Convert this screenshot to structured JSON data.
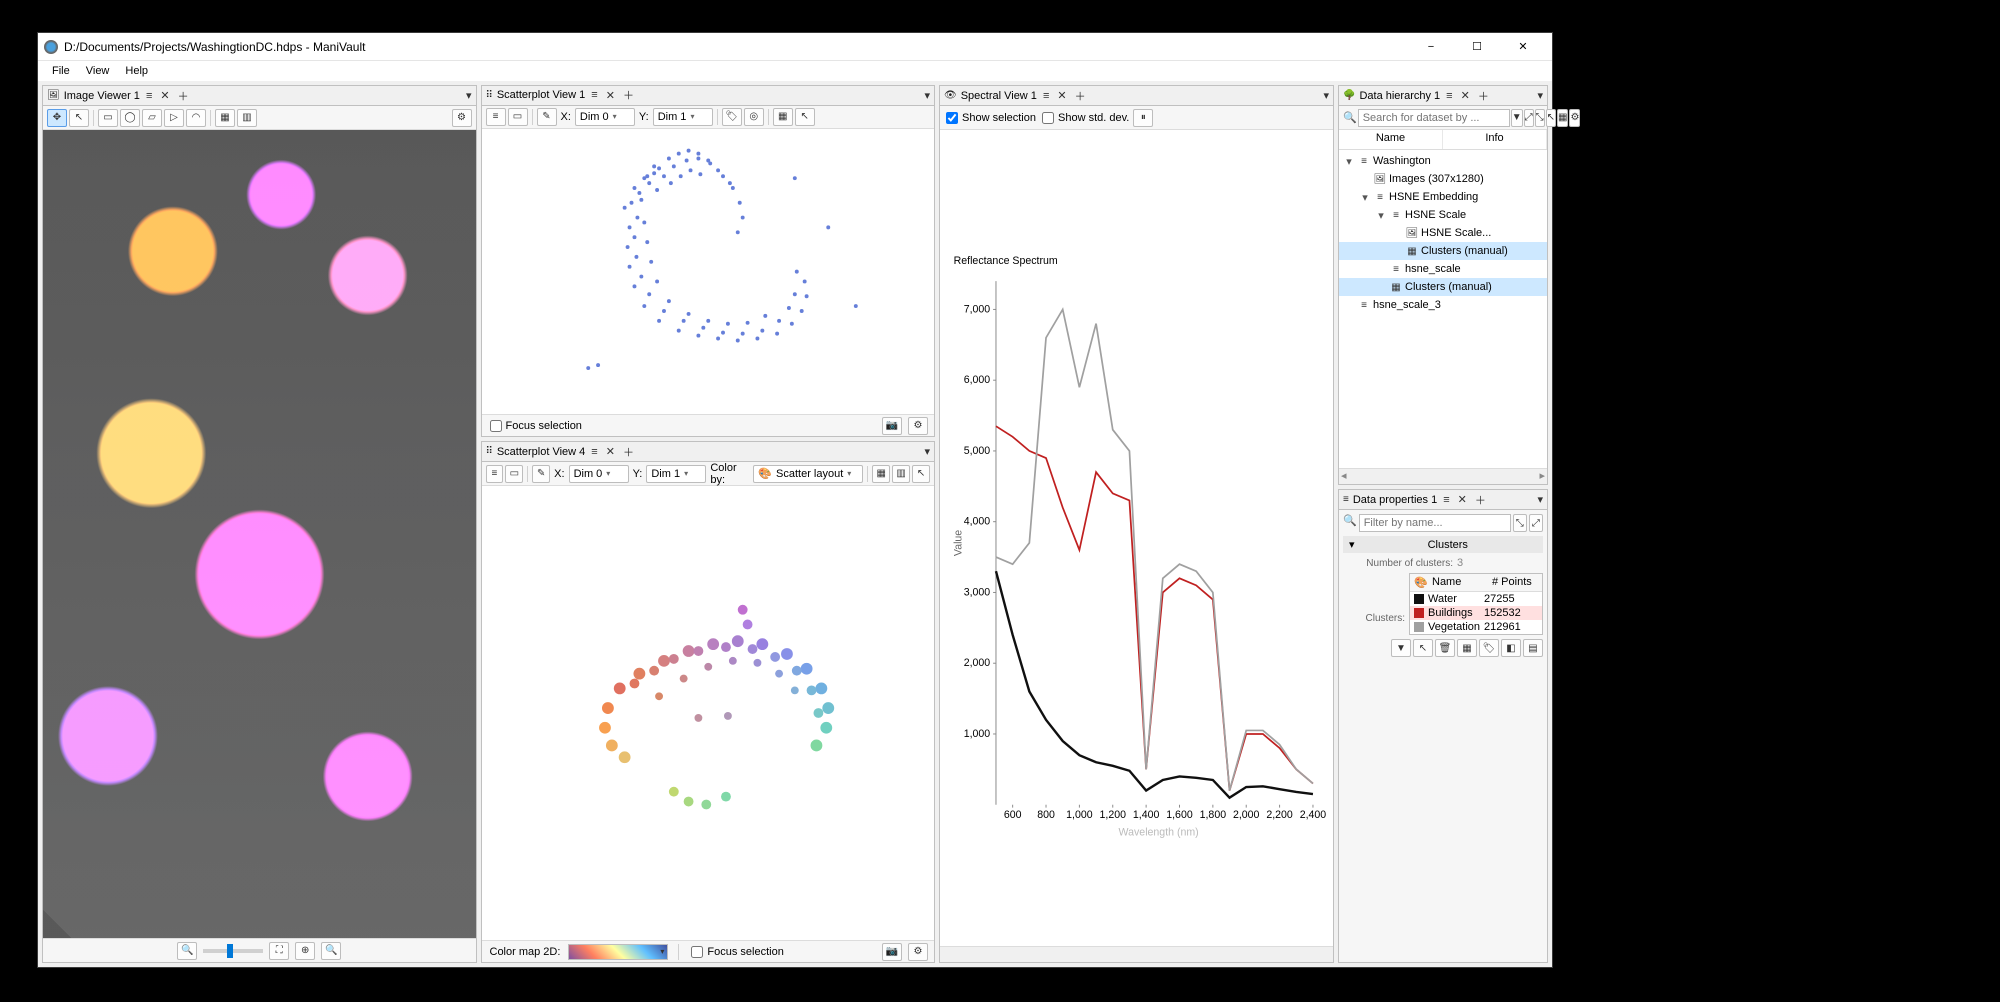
{
  "window": {
    "title": "D:/Documents/Projects/WashingtionDC.hdps - ManiVault",
    "buttons": {
      "min": "−",
      "max": "☐",
      "close": "✕"
    }
  },
  "menu": {
    "file": "File",
    "view": "View",
    "help": "Help"
  },
  "imageViewer": {
    "title": "Image Viewer 1",
    "tools": {
      "pan": "✥",
      "arrow": "↖",
      "rect": "▭",
      "ellipse": "◯",
      "poly": "▱",
      "play": "▷",
      "lasso": "◠",
      "grid": "▦",
      "settings": "⚙"
    },
    "footer": {
      "zoomOut": "⤢-",
      "fit": "⛶",
      "zoomIn": "⤢+"
    }
  },
  "scatter1": {
    "title": "Scatterplot View 1",
    "x_label": "X:",
    "x_value": "Dim 0",
    "y_label": "Y:",
    "y_value": "Dim 1",
    "focus": "Focus selection"
  },
  "scatter4": {
    "title": "Scatterplot View 4",
    "x_label": "X:",
    "x_value": "Dim 0",
    "y_label": "Y:",
    "y_value": "Dim 1",
    "colorby_label": "Color by:",
    "colorby_value": "Scatter layout",
    "cmap_label": "Color map 2D:",
    "focus": "Focus selection"
  },
  "spectral": {
    "title": "Spectral View 1",
    "show_selection": "Show selection",
    "show_std": "Show std. dev.",
    "chart_title": "Reflectance Spectrum",
    "ylabel": "Value",
    "xlabel": "Wavelength (nm)"
  },
  "hierarchy": {
    "title": "Data hierarchy 1",
    "search_placeholder": "Search for dataset by ...",
    "col_name": "Name",
    "col_info": "Info",
    "items": {
      "root": "Washington",
      "images": "Images (307x1280)",
      "hsne": "HSNE Embedding",
      "scale": "HSNE Scale",
      "scale_img": "HSNE Scale...",
      "clusters1": "Clusters (manual)",
      "hsne_scale": "hsne_scale",
      "clusters2": "Clusters (manual)",
      "hsne_scale3": "hsne_scale_3"
    }
  },
  "properties": {
    "title": "Data properties 1",
    "filter_placeholder": "Filter by name...",
    "section": "Clusters",
    "num_label": "Number of clusters:",
    "num_value": "3",
    "clusters_label": "Clusters:",
    "tbl": {
      "hdr_icon": "",
      "hdr_name": "Name",
      "hdr_points": "# Points",
      "rows": [
        {
          "color": "#101010",
          "name": "Water",
          "points": "27255"
        },
        {
          "color": "#c02020",
          "name": "Buildings",
          "points": "152532",
          "sel": true
        },
        {
          "color": "#a0a0a0",
          "name": "Vegetation",
          "points": "212961"
        }
      ]
    }
  },
  "chart_data": {
    "type": "line",
    "title": "Reflectance Spectrum",
    "xlabel": "Wavelength (nm)",
    "ylabel": "Value",
    "xlim": [
      500,
      2450
    ],
    "ylim": [
      0,
      7400
    ],
    "x": [
      500,
      600,
      700,
      800,
      900,
      1000,
      1100,
      1200,
      1300,
      1400,
      1500,
      1600,
      1700,
      1800,
      1900,
      2000,
      2100,
      2200,
      2300,
      2400
    ],
    "y_ticks": [
      1000,
      2000,
      3000,
      4000,
      5000,
      6000,
      7000
    ],
    "x_ticks": [
      600,
      800,
      1000,
      1200,
      1400,
      1600,
      1800,
      2000,
      2200,
      2400
    ],
    "series": [
      {
        "name": "Water",
        "color": "#101010",
        "values": [
          3300,
          2400,
          1600,
          1200,
          900,
          700,
          600,
          550,
          480,
          200,
          350,
          400,
          380,
          350,
          100,
          250,
          260,
          220,
          180,
          150
        ]
      },
      {
        "name": "Buildings",
        "color": "#c02020",
        "values": [
          5350,
          5200,
          5000,
          4900,
          4200,
          3600,
          4700,
          4400,
          4300,
          500,
          3000,
          3200,
          3100,
          2900,
          200,
          1000,
          1000,
          800,
          500,
          300
        ]
      },
      {
        "name": "Vegetation",
        "color": "#a0a0a0",
        "values": [
          3500,
          3400,
          3700,
          6600,
          7000,
          5900,
          6800,
          5300,
          5000,
          500,
          3200,
          3400,
          3300,
          3000,
          200,
          1050,
          1050,
          850,
          500,
          300
        ]
      }
    ]
  }
}
